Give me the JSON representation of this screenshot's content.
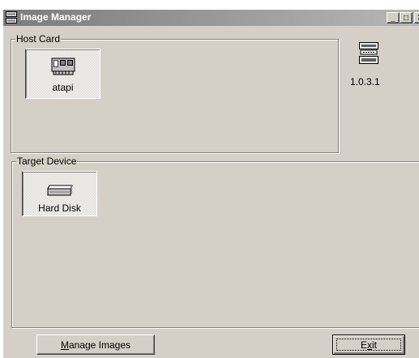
{
  "window": {
    "title": "Image Manager",
    "icon": "server-icon",
    "controls": {
      "minimize": "_",
      "maximize": "□",
      "close": "✕"
    }
  },
  "host_card": {
    "label": "Host Card",
    "items": [
      {
        "label": "atapi",
        "icon": "expansion-card-icon"
      }
    ]
  },
  "version": {
    "text": "1.0.3.1",
    "icon": "device-stack-icon"
  },
  "target_device": {
    "label": "Target Device",
    "items": [
      {
        "label": "Hard Disk",
        "icon": "hard-disk-icon"
      }
    ]
  },
  "buttons": {
    "manage_images": "Manage Images",
    "manage_images_mnemonic": "M",
    "exit": "Exit",
    "exit_mnemonic": "x"
  },
  "colors": {
    "face": "#d4d0c8",
    "titlebar_start": "#7b7b7b",
    "titlebar_end": "#b8b8b8",
    "title_text": "#ffffff"
  }
}
